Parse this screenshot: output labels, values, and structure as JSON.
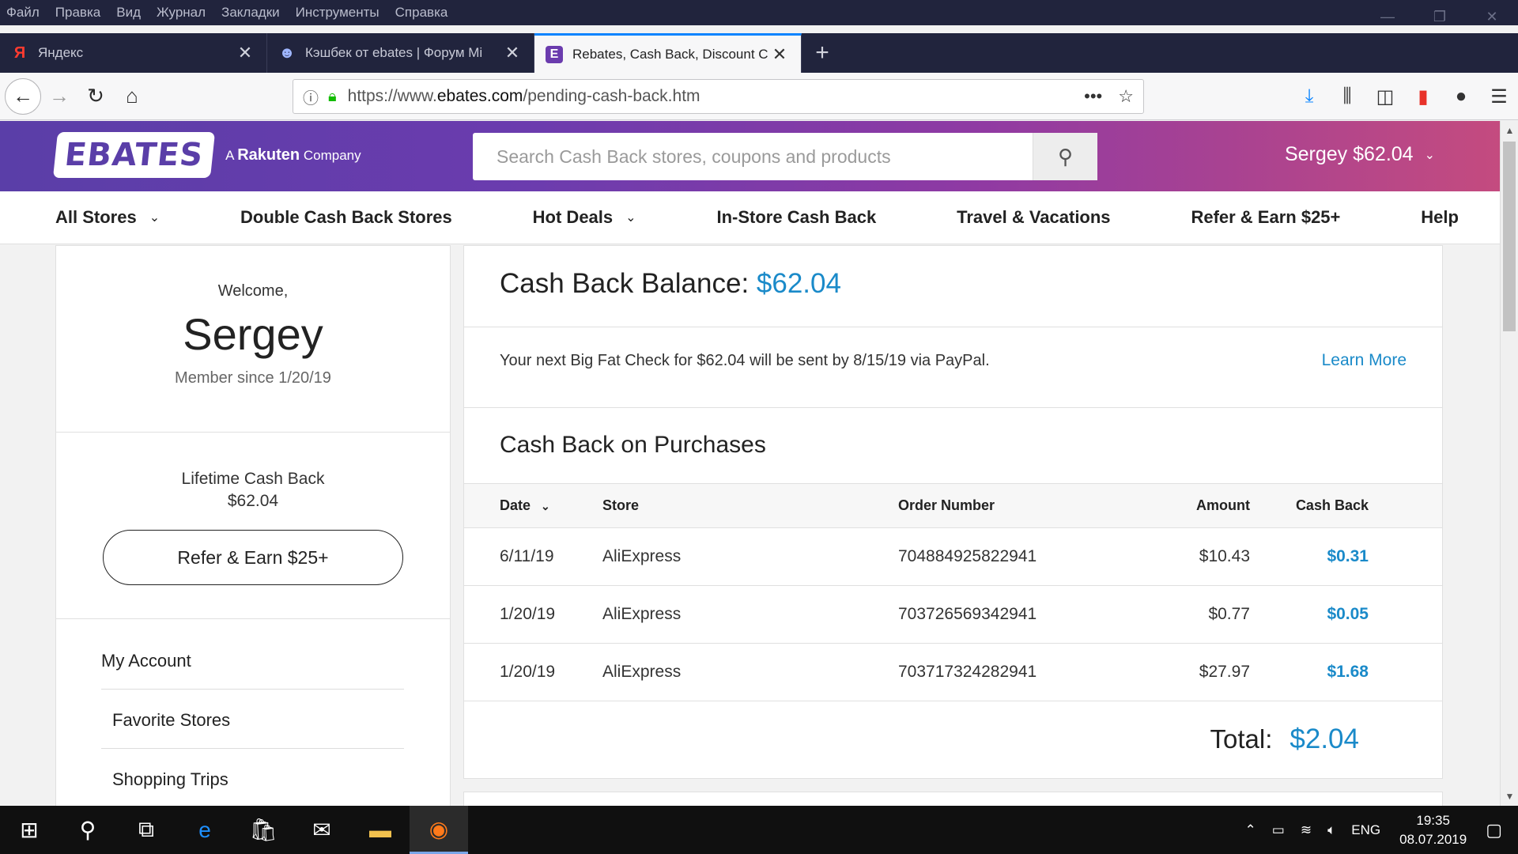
{
  "menu": [
    "Файл",
    "Правка",
    "Вид",
    "Журнал",
    "Закладки",
    "Инструменты",
    "Справка"
  ],
  "window": {
    "minimize": "—",
    "restore": "❐",
    "close": "✕"
  },
  "tabs": [
    {
      "label": "Яндекс",
      "icon": "Я",
      "active": false
    },
    {
      "label": "Кэшбек от ebates | Форум Mi",
      "icon": "☻",
      "active": false
    },
    {
      "label": "Rebates, Cash Back, Discount C",
      "icon": "E",
      "active": true
    }
  ],
  "address": {
    "prefix": "https://www.",
    "domain": "ebates.com",
    "path": "/pending-cash-back.htm"
  },
  "site": {
    "logo": "EBATES",
    "tagline_a": "A",
    "tagline_brand": "Rakuten",
    "tagline_b": "Company",
    "search_placeholder": "Search Cash Back stores, coupons and products",
    "user": "Sergey $62.04"
  },
  "nav": [
    "All Stores",
    "Double Cash Back Stores",
    "Hot Deals",
    "In-Store Cash Back",
    "Travel & Vacations",
    "Refer & Earn $25+",
    "Help"
  ],
  "sidebar": {
    "welcome": "Welcome,",
    "name": "Sergey",
    "member_since": "Member since 1/20/19",
    "lifetime_label": "Lifetime Cash Back",
    "lifetime_value": "$62.04",
    "refer_button": "Refer & Earn $25+",
    "links": [
      "My Account",
      "Favorite Stores",
      "Shopping Trips"
    ]
  },
  "balance": {
    "label": "Cash Back Balance:",
    "value": "$62.04",
    "message": "Your next Big Fat Check for $62.04 will be sent by 8/15/19 via PayPal.",
    "learn_more": "Learn More"
  },
  "purchases": {
    "title": "Cash Back on Purchases",
    "columns": {
      "date": "Date",
      "store": "Store",
      "order": "Order Number",
      "amount": "Amount",
      "cashback": "Cash Back"
    },
    "rows": [
      {
        "date": "6/11/19",
        "store": "AliExpress",
        "order": "704884925822941",
        "amount": "$10.43",
        "cashback": "$0.31"
      },
      {
        "date": "1/20/19",
        "store": "AliExpress",
        "order": "703726569342941",
        "amount": "$0.77",
        "cashback": "$0.05"
      },
      {
        "date": "1/20/19",
        "store": "AliExpress",
        "order": "703717324282941",
        "amount": "$27.97",
        "cashback": "$1.68"
      }
    ],
    "total_label": "Total:",
    "total_value": "$2.04"
  },
  "taskbar": {
    "lang": "ENG",
    "time": "19:35",
    "date": "08.07.2019"
  }
}
